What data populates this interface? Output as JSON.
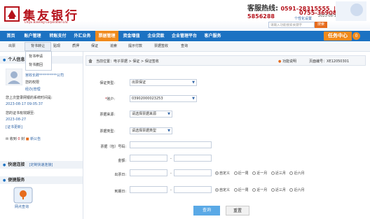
{
  "header": {
    "logo_cn": "集友银行",
    "logo_en": "Chiyu Banking Corporation Ltd.",
    "hotline_label": "客服热线:",
    "hotline1": "0591-28315555",
    "hotline2": "0592-5856288",
    "hotline3": "0755-36908888",
    "personal_settings": "个性化设置",
    "search_placeholder": "请输入功能搜索关键字",
    "search_btn": "搜索",
    "datetime": "2023-08-17 16:53:01"
  },
  "mainnav": {
    "items": [
      "首页",
      "账户管理",
      "转账支付",
      "外汇业务",
      "票据管理",
      "资金增值",
      "企业贷款",
      "企业管理平台",
      "客户服务"
    ],
    "active_index": 4,
    "task_center": "任务中心",
    "circle_num": "0"
  },
  "subnav": {
    "items": [
      "出票",
      "背书转让",
      "贴现",
      "质押",
      "保证",
      "追索",
      "提示付款",
      "票据签收",
      "查询"
    ],
    "hover_index": 1,
    "dropdown": [
      "背书申请",
      "背书撤回"
    ]
  },
  "left": {
    "section1": "个人信息",
    "company": "宫收长辞**********公司",
    "role_label": "您的权限",
    "role": "经办|管理",
    "last_login_label": "您上次登录网银的系统时间是:",
    "last_login": "2023-08-17 09:05:37",
    "cert_label": "您的证书有效期至:",
    "cert_date": "2023-08-27",
    "cert_update": "[证书更新]",
    "inbox_prefix": "收到",
    "inbox_count": "0",
    "inbox_suffix": "封",
    "new_notice": "新公告",
    "section2": "快速连接",
    "custom_link": "[定制快速连接]",
    "section3": "便捷服务",
    "net_query": "网点查询"
  },
  "breadcrumb": {
    "text": "当前位置：电子票据 > 保证 > 保证签收",
    "func_help": "功能说明",
    "page_no": "页面编号：XE12050301"
  },
  "form": {
    "guarantee_type_label": "保证类型:",
    "guarantee_type_value": "出票保证",
    "account_label": "账户:",
    "account_value": "03902000023253",
    "bill_source_label": "票据来源:",
    "bill_source_placeholder": "请选择票据来源",
    "bill_type_label": "票据类型:",
    "bill_type_placeholder": "请选择票据类型",
    "bill_no_label": "票据（包）号码:",
    "amount_label": "金额:",
    "issue_date_label": "出票日:",
    "due_date_label": "到期日:",
    "range_sep": "-",
    "radio_options": [
      "自定义",
      "近一周",
      "近一月",
      "近三月",
      "近六月"
    ],
    "query_btn": "查询",
    "reset_btn": "重置"
  },
  "colors": {
    "nav_blue": "#1c72c2",
    "active_orange": "#f08a1c",
    "brand_red": "#b5121b"
  }
}
